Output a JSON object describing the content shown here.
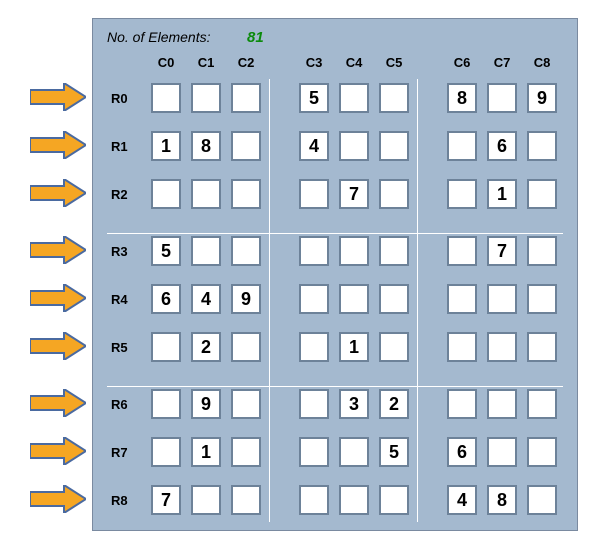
{
  "header": {
    "label": "No. of Elements:",
    "value": "81"
  },
  "columns": [
    "C0",
    "C1",
    "C2",
    "C3",
    "C4",
    "C5",
    "C6",
    "C7",
    "C8"
  ],
  "rows": [
    "R0",
    "R1",
    "R2",
    "R3",
    "R4",
    "R5",
    "R6",
    "R7",
    "R8"
  ],
  "chart_data": {
    "type": "table",
    "title": "Sudoku Grid",
    "grid": [
      [
        "",
        "",
        "",
        "5",
        "",
        "",
        "8",
        "",
        "9"
      ],
      [
        "1",
        "8",
        "",
        "4",
        "",
        "",
        "",
        "6",
        ""
      ],
      [
        "",
        "",
        "",
        "",
        "7",
        "",
        "",
        "1",
        ""
      ],
      [
        "5",
        "",
        "",
        "",
        "",
        "",
        "",
        "7",
        ""
      ],
      [
        "6",
        "4",
        "9",
        "",
        "",
        "",
        "",
        "",
        ""
      ],
      [
        "",
        "2",
        "",
        "",
        "1",
        "",
        "",
        "",
        ""
      ],
      [
        "",
        "9",
        "",
        "",
        "3",
        "2",
        "",
        "",
        ""
      ],
      [
        "",
        "1",
        "",
        "",
        "",
        "5",
        "6",
        "",
        ""
      ],
      [
        "7",
        "",
        "",
        "",
        "",
        "",
        "4",
        "8",
        ""
      ]
    ]
  },
  "colors": {
    "panel": "#a4b9cf",
    "arrow_fill": "#f5a623",
    "arrow_stroke": "#4a6aa0",
    "value": "#0b8a0b"
  }
}
